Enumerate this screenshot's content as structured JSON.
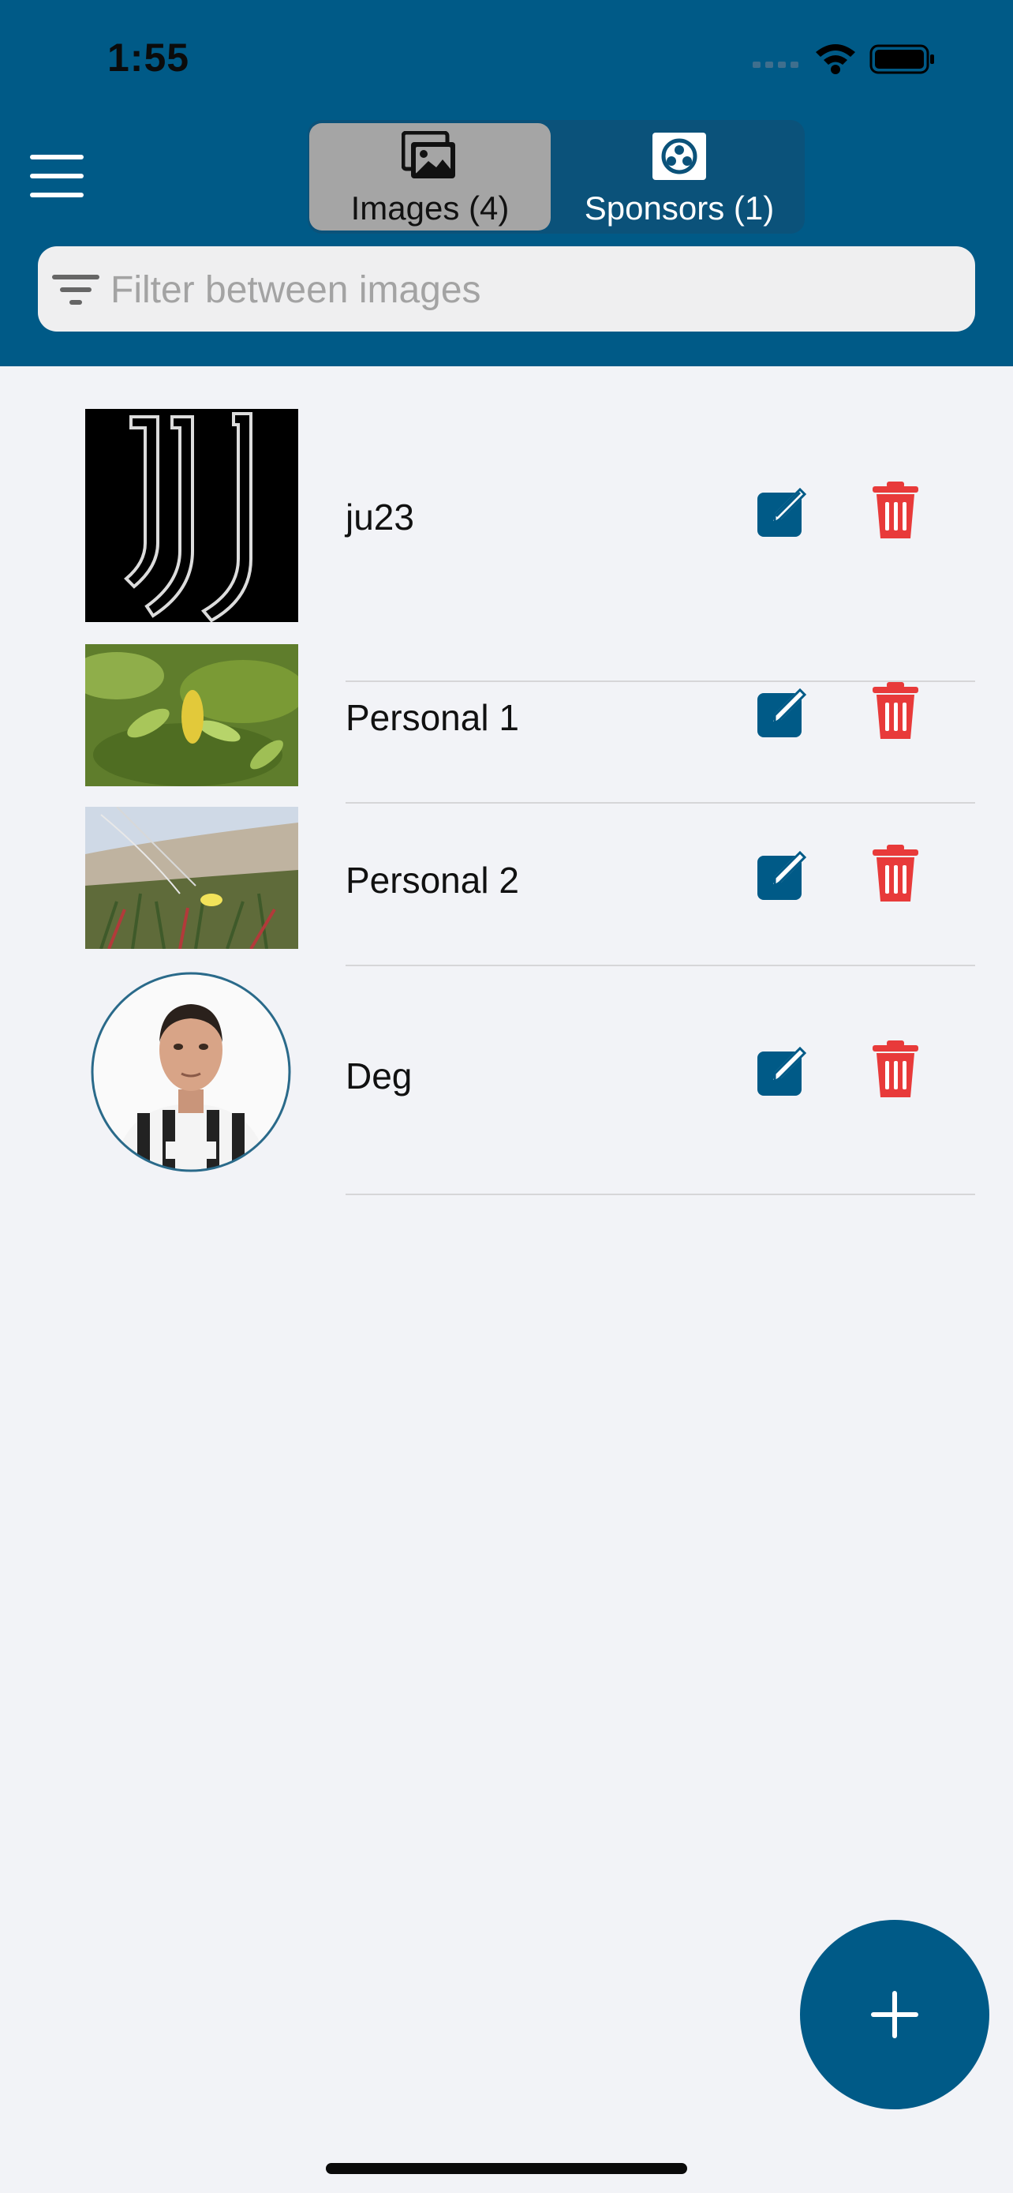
{
  "status_bar": {
    "time": "1:55"
  },
  "tabs": [
    {
      "label": "Images (4)",
      "icon": "images-icon",
      "selected": true
    },
    {
      "label": "Sponsors (1)",
      "icon": "sponsor-icon",
      "selected": false
    }
  ],
  "filter": {
    "placeholder": "Filter between images",
    "value": ""
  },
  "items": [
    {
      "name": "ju23"
    },
    {
      "name": "Personal 1"
    },
    {
      "name": "Personal 2"
    },
    {
      "name": "Deg"
    }
  ],
  "colors": {
    "header": "#005a87",
    "selected_tab": "#a5a5a5",
    "edit": "#005a87",
    "delete": "#e83a3a",
    "background": "#f2f3f7"
  }
}
